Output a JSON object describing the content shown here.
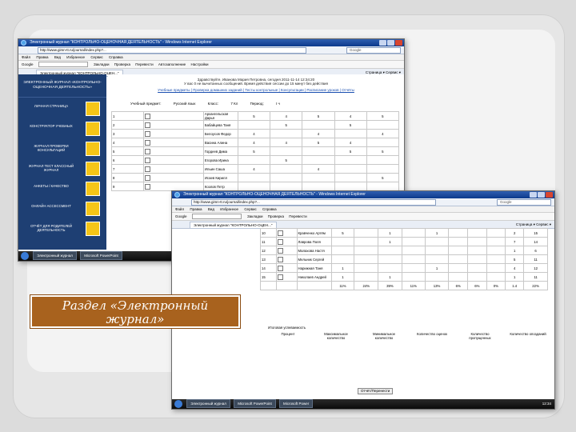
{
  "caption": {
    "text": "Раздел «Электронный журнал»"
  },
  "window1": {
    "title": "Электронный журнал \"КОНТРОЛЬНО-ОЦЕНОЧНАЯ ДЕЯТЕЛЬНОСТЬ\" - Windows Internet Explorer",
    "url": "http://www.gimn-tt.ru/journal/index.php?...",
    "search_placeholder": "Google",
    "menu": [
      "Файл",
      "Правка",
      "Вид",
      "Избранное",
      "Сервис",
      "Справка"
    ],
    "toolbar": [
      "Google",
      "Закладки",
      "Проверка",
      "Перевести",
      "Автозаполнение",
      "Настройки"
    ],
    "tab_label": "Электронный журнал \"КОНТРОЛЬНО-ОЦЕН...\"",
    "tab_right": "Страница ▾  Сервис ▾",
    "logo": "ЭЛЕКТРОННЫЙ ЖУРНАЛ «КОНТРОЛЬНО-ОЦЕНОЧНАЯ ДЕЯТЕЛЬНОСТЬ»",
    "sidebar": [
      "ЛИЧНАЯ СТРАНИЦА",
      "КОНСТРУКТОР УЧЕБНЫХ",
      "ЖУРНАЛ ПРОВЕРКИ КОНСУЛЬТАЦИЙ",
      "ЖУРНАЛ ТЕСТ КЛАССНЫЙ ЖУРНАЛ",
      "АНКЕТЫ / КАЧЕСТВО",
      "ОНЛАЙН АССЕССМЕНТ",
      "ОТЧЁТ ДЛЯ РОДИТЕЛЕЙ ДЕЯТЕЛЬНОСТЬ"
    ],
    "info": "Здравствуйте, Иванова Мария Петровна, сегодня 2011-11-14 12:34:20",
    "info2": "У вас 0 не вычитанных сообщений. Время действия сессии до 15 минут без действия",
    "links": "Учебные предметы | Проверка домашних заданий | Тесты контрольные | Консультации | Расписание уроков | Отчёты",
    "filters": [
      "Учебный предмет:",
      "Русский язык",
      "Класс:",
      "7 Кл",
      "Период:",
      "I ч"
    ],
    "rows": [
      {
        "n": "1",
        "name": "Архангельская Дарья",
        "marks": [
          "5",
          "4",
          "5",
          "4",
          "5"
        ]
      },
      {
        "n": "2",
        "name": "Бабайцева Таня",
        "marks": [
          "",
          "5",
          "",
          "5",
          ""
        ]
      },
      {
        "n": "3",
        "name": "Белоусов Федор",
        "marks": [
          "4",
          "",
          "4",
          "",
          "4"
        ]
      },
      {
        "n": "4",
        "name": "Васина Алина",
        "marks": [
          "4",
          "4",
          "5",
          "4",
          ""
        ]
      },
      {
        "n": "5",
        "name": "Гордеев Дима",
        "marks": [
          "5",
          "",
          "",
          "5",
          "5"
        ]
      },
      {
        "n": "6",
        "name": "Егорова Ирина",
        "marks": [
          "",
          "5",
          "",
          "",
          ""
        ]
      },
      {
        "n": "7",
        "name": "Ильин Саша",
        "marks": [
          "4",
          "",
          "4",
          "",
          ""
        ]
      },
      {
        "n": "8",
        "name": "Исаев Кирилл",
        "marks": [
          "",
          "",
          "",
          "",
          "5"
        ]
      },
      {
        "n": "9",
        "name": "Козлов Петр",
        "marks": [
          "",
          "",
          "",
          "",
          ""
        ]
      }
    ],
    "taskbar": [
      "Электронный журнал",
      "Microsoft PowerPoint"
    ]
  },
  "window2": {
    "title": "Электронный журнал \"КОНТРОЛЬНО-ОЦЕНОЧНАЯ ДЕЯТЕЛЬНОСТЬ\" - Windows Internet Explorer",
    "url": "http://www.gimn-tt.ru/journal/index.php?...",
    "tab_label": "Электронный журнал \"КОНТРОЛЬНО-ОЦЕН...\"",
    "rows": [
      {
        "n": "10",
        "name": "Кравченко Артём",
        "marks": [
          "5",
          "",
          "1",
          "",
          "1",
          "",
          "",
          "",
          "2",
          "15"
        ]
      },
      {
        "n": "11",
        "name": "Лаврова Поля",
        "marks": [
          "",
          "",
          "1",
          "",
          "",
          "",
          "",
          "",
          "7",
          "14"
        ]
      },
      {
        "n": "12",
        "name": "Малахова Настя",
        "marks": [
          "",
          "",
          "",
          "",
          "",
          "",
          "",
          "",
          "1",
          "6"
        ]
      },
      {
        "n": "13",
        "name": "Мельник Сергей",
        "marks": [
          "",
          "",
          "",
          "",
          "",
          "",
          "",
          "",
          "5",
          "11"
        ]
      },
      {
        "n": "14",
        "name": "Нарижная Таня",
        "marks": [
          "1",
          "",
          "",
          "",
          "1",
          "",
          "",
          "",
          "4",
          "12"
        ]
      },
      {
        "n": "15",
        "name": "Николаев Андрей",
        "marks": [
          "1",
          "",
          "1",
          "",
          "",
          "",
          "",
          "",
          "1",
          "11"
        ]
      }
    ],
    "summary": [
      "11%",
      "24%",
      "39%",
      "11%",
      "13%",
      "6%",
      "6%",
      "0%",
      "1.4",
      "22%"
    ],
    "footer_left": "Итоговая успеваемость",
    "footer_labels": [
      "Процент",
      "Максимальное количество",
      "Минимальное количество",
      "Количество оценок",
      "Количество пропущенных",
      "Количество опозданий"
    ],
    "btn_report": "Отчёт/Перенести",
    "taskbar": [
      "Электронный журнал",
      "Microsoft PowerPoint",
      "Microsoft Power"
    ],
    "clock": "12:34"
  }
}
